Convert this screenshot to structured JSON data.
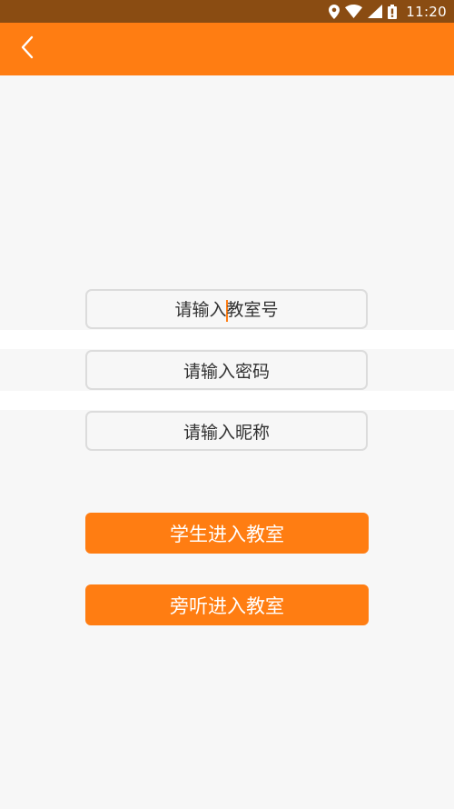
{
  "status_bar": {
    "time": "11:20",
    "icons": [
      "location-icon",
      "wifi-icon",
      "signal-icon",
      "battery-icon"
    ]
  },
  "app_bar": {
    "back_icon": "chevron-left-icon",
    "color": "#ff7d12"
  },
  "form": {
    "room_number": {
      "placeholder_before_caret": "请输入",
      "placeholder_after_caret": "教室号",
      "focused": true
    },
    "password": {
      "placeholder": "请输入密码"
    },
    "nickname": {
      "placeholder": "请输入昵称"
    }
  },
  "actions": {
    "student_enter": "学生进入教室",
    "audit_enter": "旁听进入教室"
  },
  "colors": {
    "accent": "#ff7d12",
    "status_bar": "#8a4c12",
    "background": "#f7f7f7"
  }
}
